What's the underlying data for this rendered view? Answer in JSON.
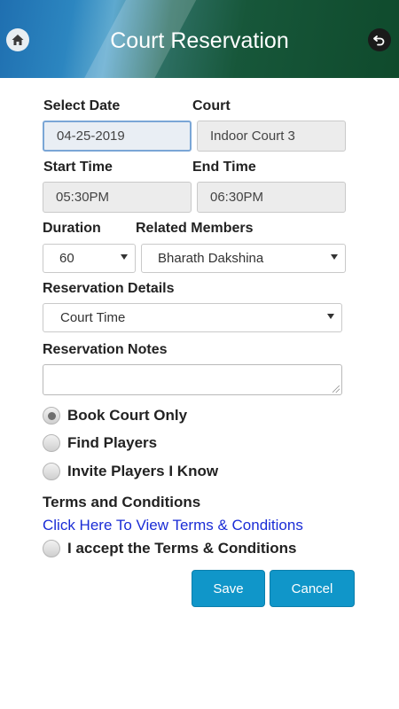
{
  "header": {
    "title": "Court Reservation",
    "home_icon": "home-icon",
    "back_icon": "undo-icon"
  },
  "form": {
    "select_date": {
      "label": "Select Date",
      "value": "04-25-2019"
    },
    "court": {
      "label": "Court",
      "value": "Indoor Court 3"
    },
    "start_time": {
      "label": "Start Time",
      "value": "05:30PM"
    },
    "end_time": {
      "label": "End Time",
      "value": "06:30PM"
    },
    "duration": {
      "label": "Duration",
      "value": "60"
    },
    "related_members": {
      "label": "Related Members",
      "value": "Bharath Dakshina"
    },
    "reservation_details": {
      "label": "Reservation Details",
      "value": "Court Time"
    },
    "reservation_notes": {
      "label": "Reservation Notes",
      "value": ""
    }
  },
  "options": [
    {
      "label": "Book Court Only",
      "selected": true
    },
    {
      "label": "Find Players",
      "selected": false
    },
    {
      "label": "Invite Players I Know",
      "selected": false
    }
  ],
  "terms": {
    "heading": "Terms and Conditions",
    "link": "Click Here To View Terms & Conditions",
    "accept_label": "I accept the Terms & Conditions",
    "accepted": false
  },
  "buttons": {
    "save": "Save",
    "cancel": "Cancel"
  },
  "colors": {
    "accent": "#1096c9",
    "link": "#1a2cd6",
    "header_green": "#0f4a2c"
  }
}
